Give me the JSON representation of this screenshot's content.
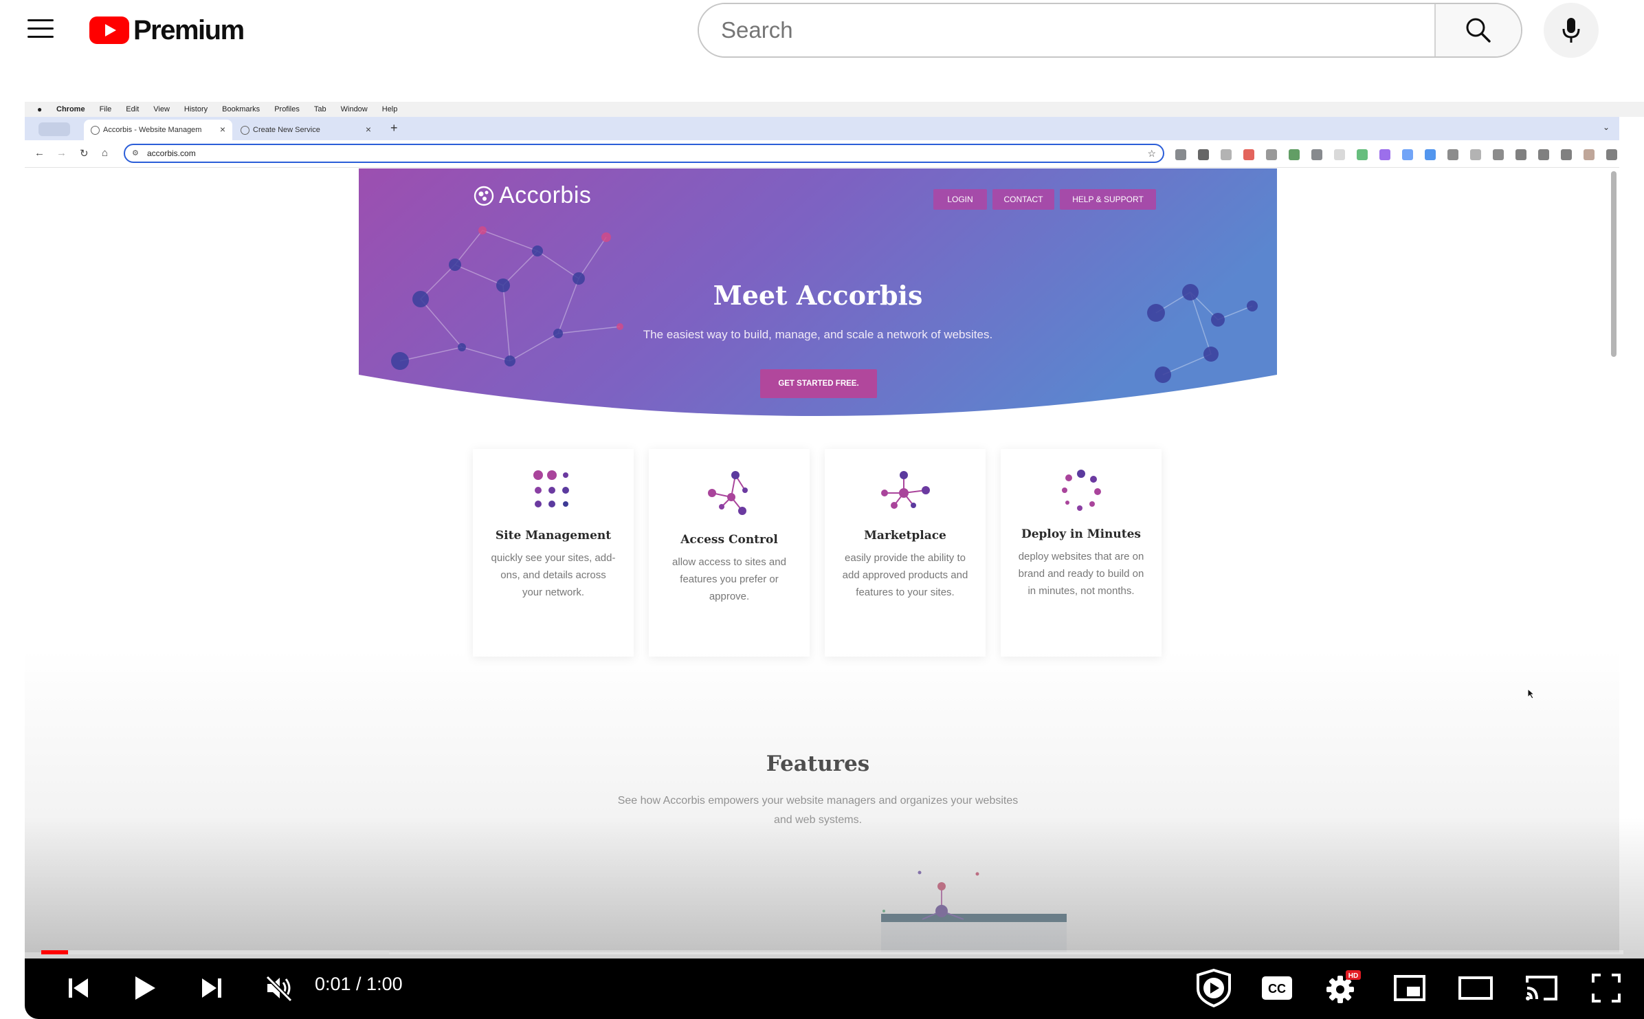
{
  "yt": {
    "brand": "Premium",
    "search_placeholder": "Search"
  },
  "mac_menu": [
    "Chrome",
    "File",
    "Edit",
    "View",
    "History",
    "Bookmarks",
    "Profiles",
    "Tab",
    "Window",
    "Help"
  ],
  "browser": {
    "tabs": [
      {
        "label": "Accorbis - Website Managem"
      },
      {
        "label": "Create New Service"
      }
    ],
    "url": "accorbis.com"
  },
  "site": {
    "logo": "Accorbis",
    "nav": [
      "LOGIN",
      "CONTACT",
      "HELP & SUPPORT"
    ],
    "hero_title": "Meet Accorbis",
    "hero_sub": "The easiest way to build, manage, and scale a network of websites.",
    "cta": "GET STARTED FREE.",
    "cards": [
      {
        "title": "Site Management",
        "text": "quickly see your sites, add-ons, and details across your network."
      },
      {
        "title": "Access Control",
        "text": "allow access to sites and features you prefer or approve."
      },
      {
        "title": "Marketplace",
        "text": "easily provide the ability to add approved products and features to your sites."
      },
      {
        "title": "Deploy in Minutes",
        "text": "deploy websites that are on brand and ready to build on in minutes, not months."
      }
    ],
    "features_title": "Features",
    "features_sub": "See how Accorbis empowers your website managers and organizes your websites and web systems."
  },
  "player": {
    "time": "0:01 / 1:00",
    "progress": 0.017,
    "loaded": 0.22
  },
  "colors": {
    "yt_red": "#ff0000",
    "hero_purple": "#9c4fb0",
    "hero_blue": "#5b86cf",
    "accent_magenta": "#b1479c"
  },
  "icons": [
    "menu-icon",
    "youtube-logo-icon",
    "search-icon",
    "mic-icon",
    "skip-back-icon",
    "play-icon",
    "skip-next-icon",
    "muted-icon",
    "miniplayer-icon",
    "cc-icon",
    "settings-icon",
    "picture-in-picture-icon",
    "theater-icon",
    "cast-icon",
    "fullscreen-icon"
  ]
}
